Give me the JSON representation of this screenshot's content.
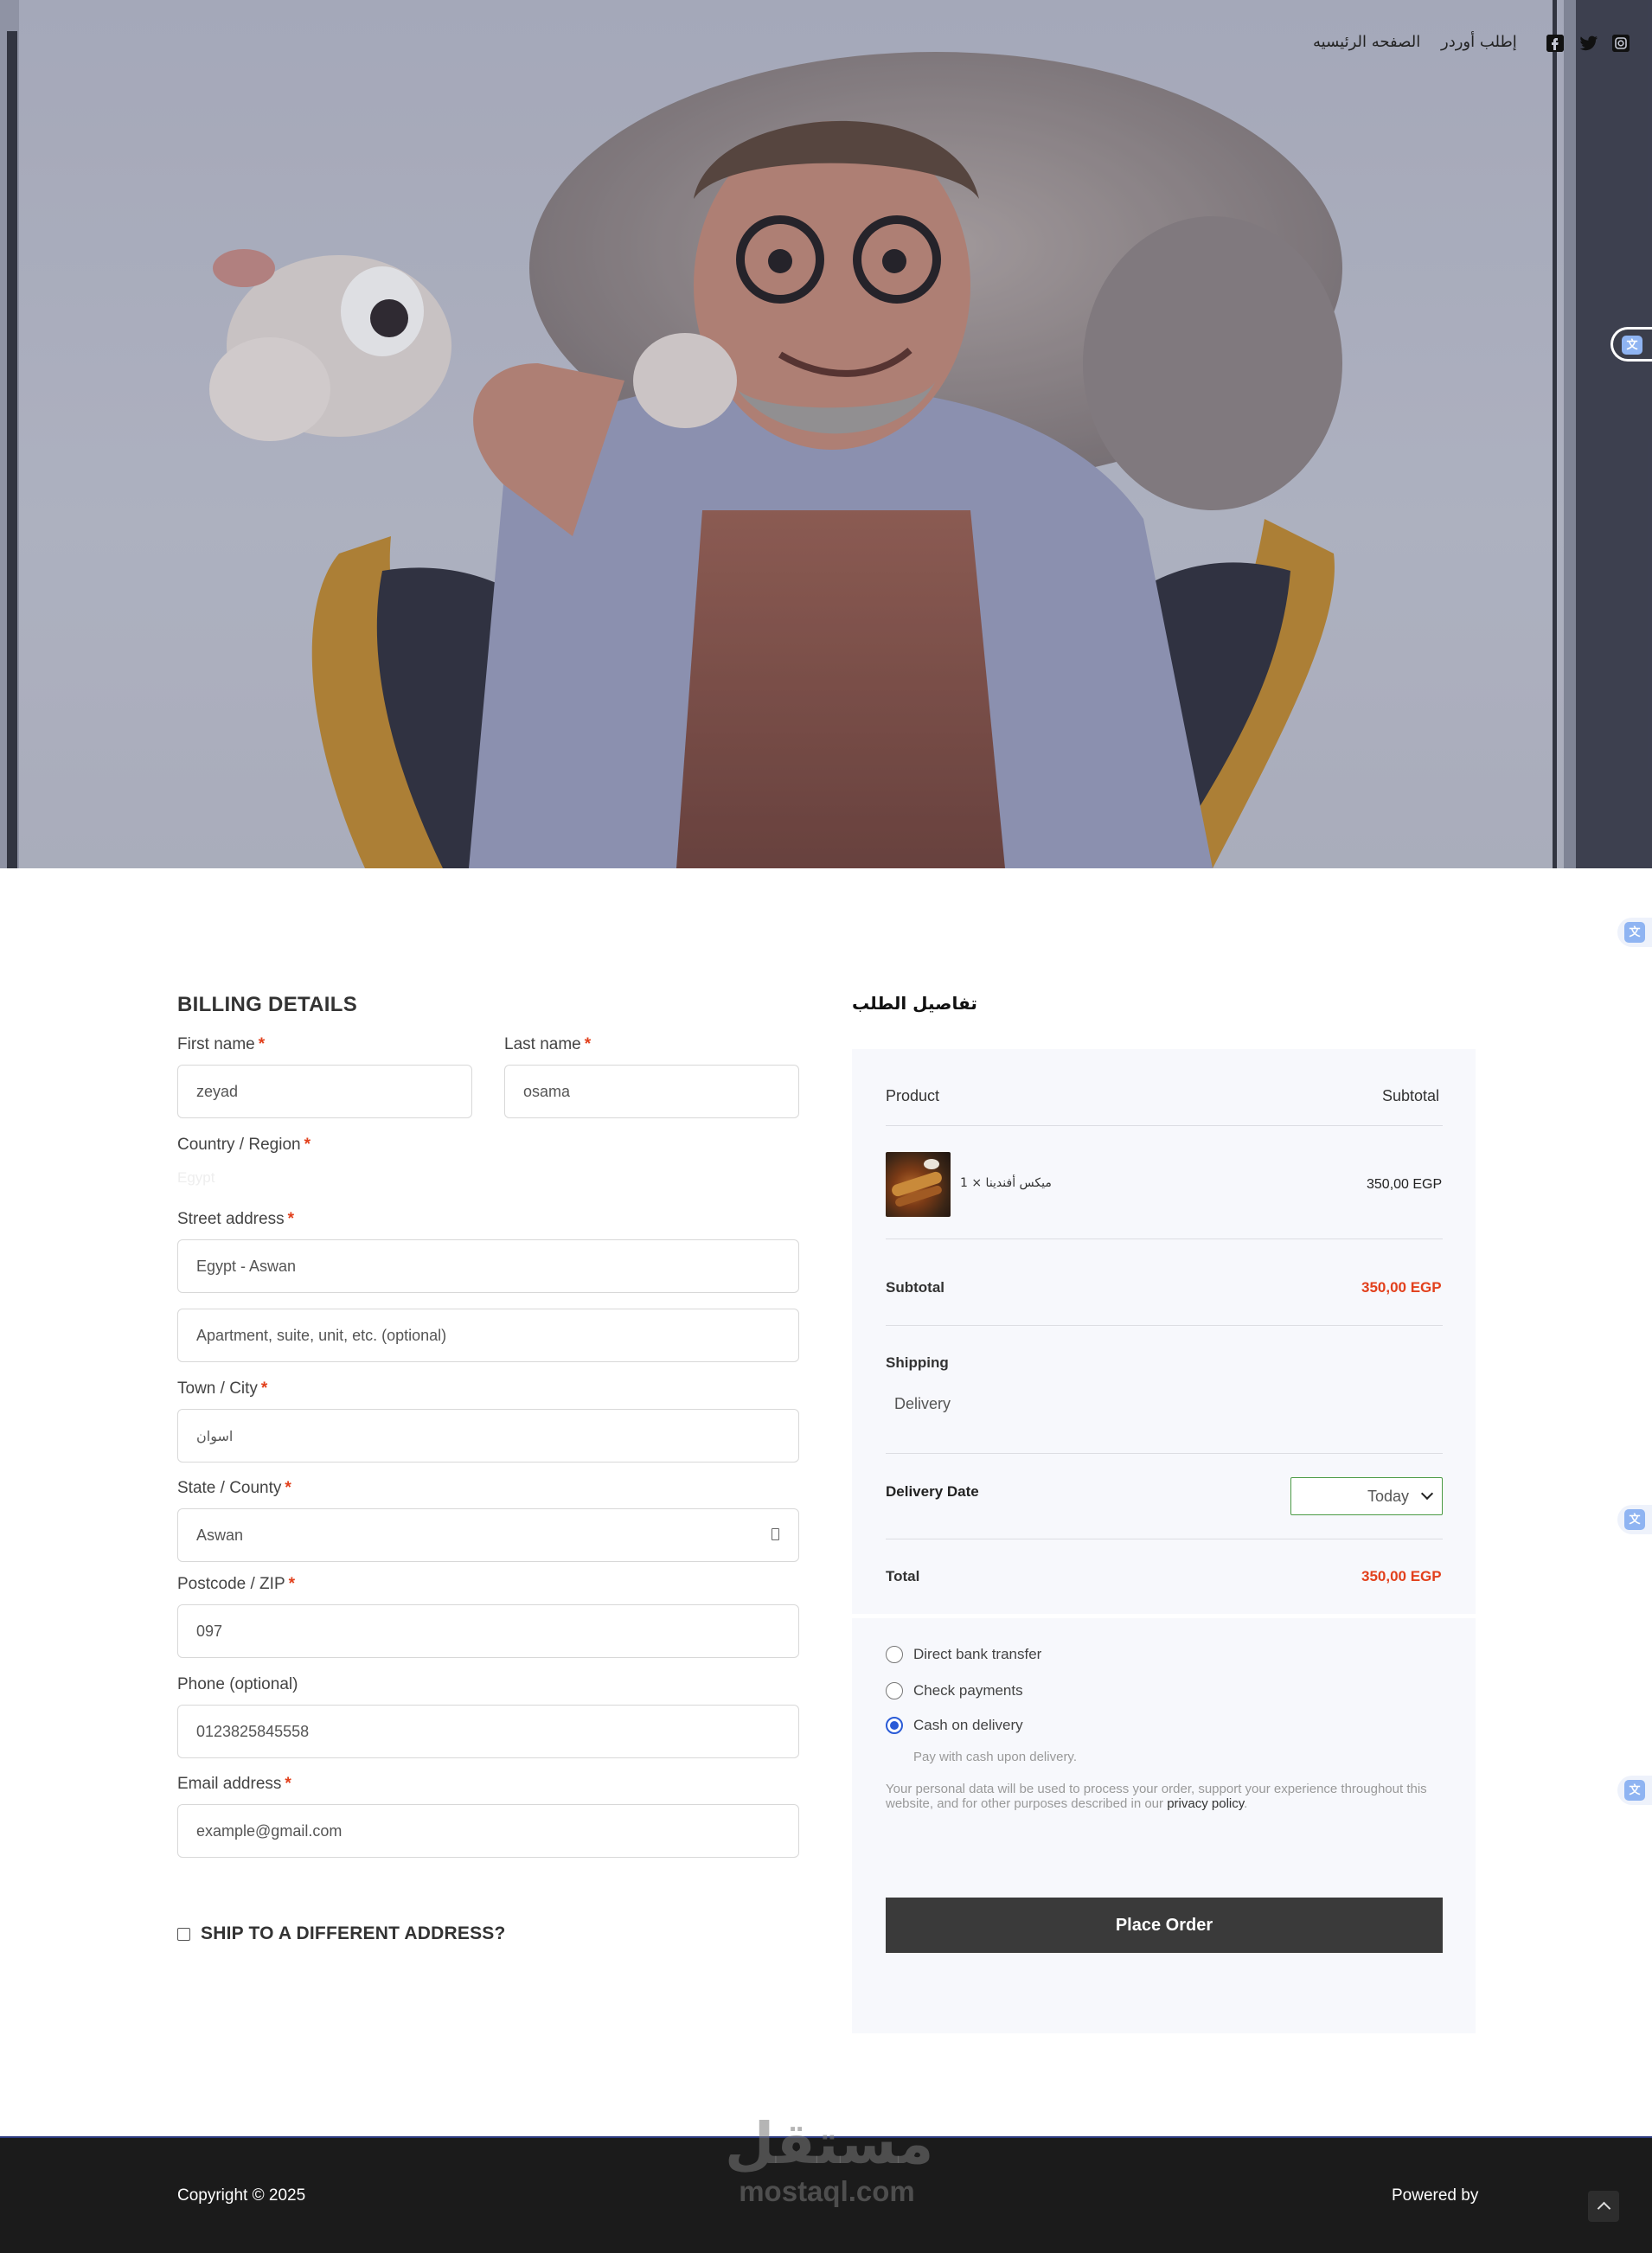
{
  "nav": {
    "home": "الصفحه الرئيسيه",
    "order": "إطلب أوردر"
  },
  "icons": {
    "facebook": "facebook-icon",
    "twitter": "twitter-icon",
    "instagram": "instagram-icon",
    "translate": "translate-icon"
  },
  "billing": {
    "title": "BILLING DETAILS",
    "first_name_label": "First name",
    "first_name_value": "zeyad",
    "last_name_label": "Last name",
    "last_name_value": "osama",
    "country_label": "Country / Region",
    "country_value": "Egypt",
    "street_label": "Street address",
    "street_value": "Egypt - Aswan",
    "street2_placeholder": "Apartment, suite, unit, etc. (optional)",
    "town_label": "Town / City",
    "town_value": "اسوان",
    "state_label": "State / County",
    "state_value": "Aswan",
    "postcode_label": "Postcode / ZIP",
    "postcode_value": "097",
    "phone_label": "Phone (optional)",
    "phone_value": "0123825845558",
    "email_label": "Email address",
    "email_value": "example@gmail.com",
    "required_mark": "*",
    "ship_label": "SHIP TO A DIFFERENT ADDRESS?"
  },
  "order": {
    "title": "تفاصيل الطلب",
    "col_product": "Product",
    "col_subtotal": "Subtotal",
    "item_name": "1 × ميكس أفندينا",
    "item_price": "350,00 EGP",
    "subtotal_label": "Subtotal",
    "subtotal_value": "350,00 EGP",
    "shipping_label": "Shipping",
    "shipping_method": "Delivery",
    "delivery_date_label": "Delivery Date",
    "delivery_date_value": "Today",
    "total_label": "Total",
    "total_value": "350,00 EGP"
  },
  "payment": {
    "options": [
      "Direct bank transfer",
      "Check payments",
      "Cash on delivery"
    ],
    "selected": "Cash on delivery",
    "cod_note": "Pay with cash upon delivery.",
    "privacy_text": "Your personal data will be used to process your order, support your experience throughout this website, and for other purposes described in our",
    "privacy_link": "privacy policy",
    "privacy_period": ".",
    "place_order": "Place Order"
  },
  "footer": {
    "copyright": "Copyright © 2025",
    "powered_by": "Powered by"
  },
  "watermark": {
    "arabic": "مستقل",
    "latin": "mostaql.com"
  },
  "colors": {
    "accent_red": "#e2401c",
    "button_dark": "#3a3a3a",
    "radio_blue": "#2a5bd7",
    "footer_bg": "#1b1b1b"
  }
}
